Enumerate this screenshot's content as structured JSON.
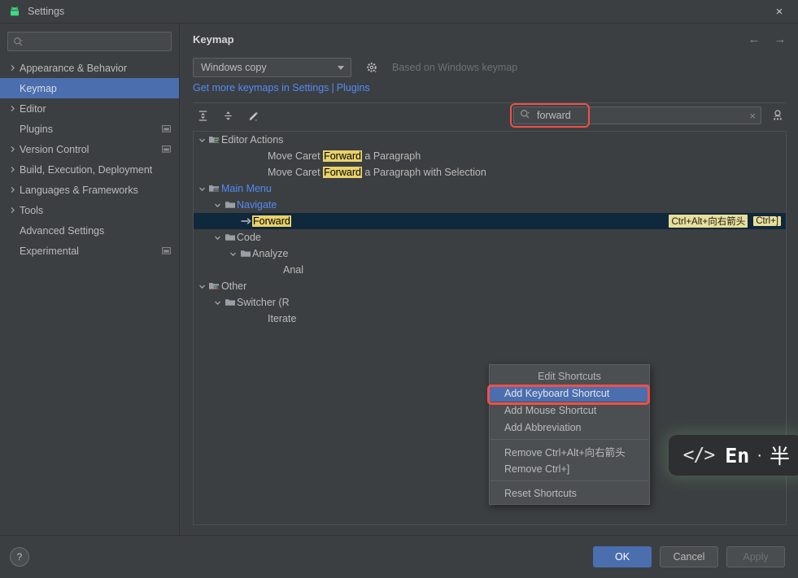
{
  "window": {
    "title": "Settings",
    "app_icon": "android-icon",
    "close_label": "×"
  },
  "sidebar": {
    "search": {
      "value": "",
      "placeholder": ""
    },
    "items": [
      {
        "label": "Appearance & Behavior",
        "twisty": "›",
        "selected": false,
        "badge": false
      },
      {
        "label": "Keymap",
        "twisty": "",
        "selected": true,
        "badge": false
      },
      {
        "label": "Editor",
        "twisty": "›",
        "selected": false,
        "badge": false
      },
      {
        "label": "Plugins",
        "twisty": "",
        "selected": false,
        "badge": true
      },
      {
        "label": "Version Control",
        "twisty": "›",
        "selected": false,
        "badge": true
      },
      {
        "label": "Build, Execution, Deployment",
        "twisty": "›",
        "selected": false,
        "badge": false
      },
      {
        "label": "Languages & Frameworks",
        "twisty": "›",
        "selected": false,
        "badge": false
      },
      {
        "label": "Tools",
        "twisty": "›",
        "selected": false,
        "badge": false
      },
      {
        "label": "Advanced Settings",
        "twisty": "",
        "selected": false,
        "badge": false
      },
      {
        "label": "Experimental",
        "twisty": "",
        "selected": false,
        "badge": true
      }
    ]
  },
  "content": {
    "title": "Keymap",
    "back_arrow": "←",
    "forward_arrow": "→",
    "keymap_select": "Windows copy",
    "based_on": "Based on Windows keymap",
    "link_prefix": "Get more keymaps in Settings",
    "link_separator": "|",
    "link_suffix": "Plugins",
    "toolbar": {
      "expand_all": "expand-all-icon",
      "collapse_all": "collapse-all-icon",
      "edit": "edit-pencil-icon"
    },
    "find": {
      "value": "forward",
      "clear": "×"
    }
  },
  "tree": {
    "rows": [
      {
        "id": "editor-actions",
        "indent": 0,
        "twisty": "∨",
        "icon": "folder-editor-icon",
        "label": "Editor Actions",
        "blue": false
      },
      {
        "id": "move-caret-forward-paragraph",
        "indent": 3,
        "twisty": "",
        "icon": "",
        "label_pre": "Move Caret ",
        "label_hl": "Forward",
        "label_post": " a Paragraph",
        "blue": false
      },
      {
        "id": "move-caret-forward-paragraph-selection",
        "indent": 3,
        "twisty": "",
        "icon": "",
        "label_pre": "Move Caret ",
        "label_hl": "Forward",
        "label_post": " a Paragraph with Selection",
        "blue": false
      },
      {
        "id": "main-menu",
        "indent": 0,
        "twisty": "∨",
        "icon": "folder-menu-icon",
        "label": "Main Menu",
        "blue": true
      },
      {
        "id": "navigate",
        "indent": 1,
        "twisty": "∨",
        "icon": "folder-icon",
        "label": "Navigate",
        "blue": true
      },
      {
        "id": "forward-action",
        "indent": 2,
        "twisty": "",
        "icon": "arrow-right-icon",
        "label_hl": "Forward",
        "selected": true,
        "shortcuts": [
          "Ctrl+Alt+向右箭头",
          "Ctrl+]"
        ]
      },
      {
        "id": "code",
        "indent": 1,
        "twisty": "∨",
        "icon": "folder-icon",
        "label": "Code",
        "blue": false
      },
      {
        "id": "analyze",
        "indent": 2,
        "twisty": "∨",
        "icon": "folder-icon",
        "label": "Analyze",
        "blue": false
      },
      {
        "id": "analyze-child",
        "indent": 4,
        "twisty": "",
        "icon": "",
        "label": "Anal",
        "blue": false
      },
      {
        "id": "other",
        "indent": 0,
        "twisty": "∨",
        "icon": "folder-other-icon",
        "label": "Other",
        "blue": false
      },
      {
        "id": "switcher",
        "indent": 1,
        "twisty": "∨",
        "icon": "folder-icon",
        "label": "Switcher (R",
        "blue": false
      },
      {
        "id": "iterate",
        "indent": 3,
        "twisty": "",
        "icon": "",
        "label": "Iterate",
        "blue": false
      }
    ]
  },
  "context_menu": {
    "items": [
      {
        "label": "Edit Shortcuts",
        "kind": "header",
        "active": false
      },
      {
        "label": "Add Keyboard Shortcut",
        "kind": "item",
        "active": true
      },
      {
        "label": "Add Mouse Shortcut",
        "kind": "item",
        "active": false
      },
      {
        "label": "Add Abbreviation",
        "kind": "item",
        "active": false
      },
      {
        "label": "",
        "kind": "separator",
        "active": false
      },
      {
        "label": "Remove Ctrl+Alt+向右箭头",
        "kind": "item",
        "active": false
      },
      {
        "label": "Remove Ctrl+]",
        "kind": "item",
        "active": false
      },
      {
        "label": "",
        "kind": "separator",
        "active": false
      },
      {
        "label": "Reset Shortcuts",
        "kind": "item",
        "active": false
      }
    ]
  },
  "ime_widget": {
    "code_glyph": "</>",
    "lang": "En",
    "dot": "·",
    "width_mode": "半"
  },
  "footer": {
    "help": "?",
    "ok": "OK",
    "cancel": "Cancel",
    "apply": "Apply"
  },
  "colors": {
    "window_bg": "#3c3f41",
    "selection_blue": "#4b6eaf",
    "tree_selection": "#10283c",
    "link_blue": "#548af7",
    "highlight_yellow": "#e8d26a",
    "annotation_red": "#f0504a",
    "android_green": "#3ddc84"
  }
}
